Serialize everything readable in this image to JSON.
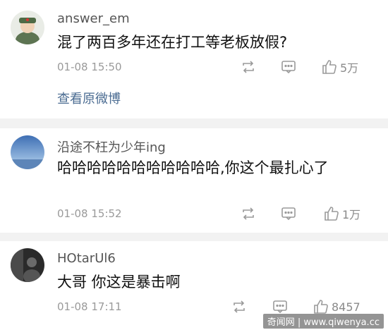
{
  "comments": [
    {
      "username": "answer_em",
      "text": "混了两百多年还在打工等老板放假?",
      "time": "01-08 15:50",
      "likes": "5万",
      "link": "查看原微博"
    },
    {
      "username": "沿途不枉为少年ing",
      "text": "哈哈哈哈哈哈哈哈哈哈哈,你这个最扎心了",
      "time": "01-08 15:52",
      "likes": "1万"
    },
    {
      "username": "HOtarUl6",
      "text": "大哥 你这是暴击啊",
      "time": "01-08 17:11",
      "likes": "8457"
    }
  ],
  "icons": {
    "repost": "repost-icon",
    "comment": "comment-icon",
    "like": "thumbs-up-icon"
  },
  "watermark": "奇闻网 | www.qiwenya.cc",
  "colors": {
    "link": "#4b6c92",
    "meta": "#9a9a9a",
    "divider": "#f2f2f2"
  }
}
